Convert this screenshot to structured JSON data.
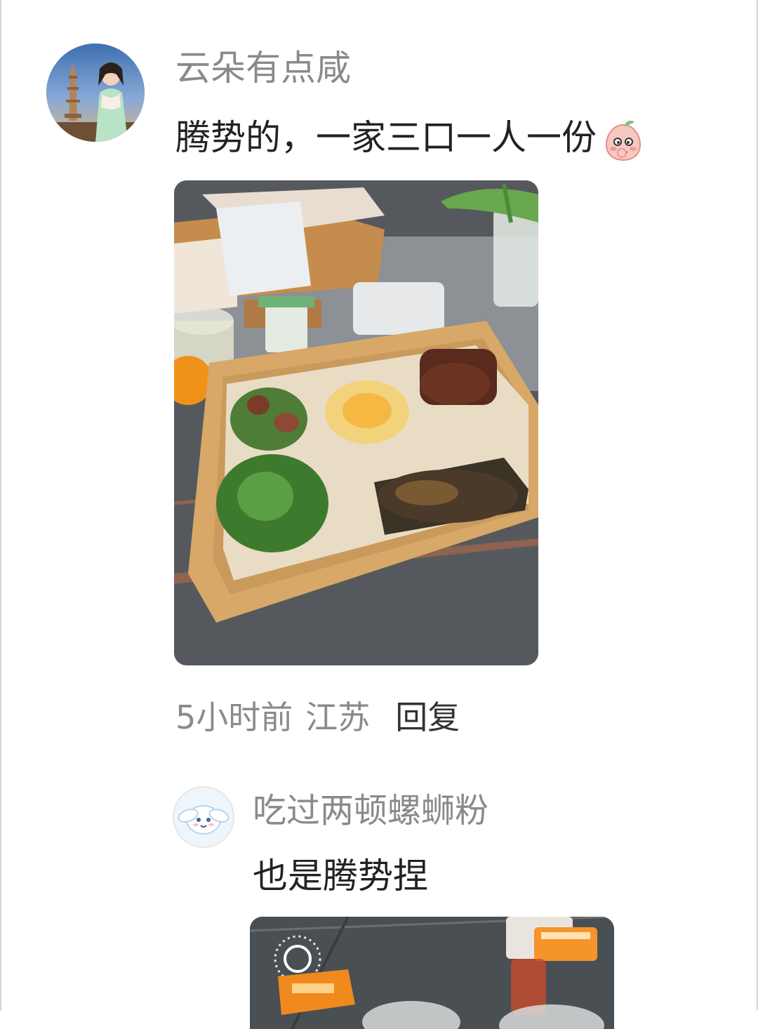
{
  "comment": {
    "username": "云朵有点咸",
    "text": "腾势的，一家三口一人一份",
    "emoji": "peach-blush-emoji",
    "time": "5小时前",
    "location": "江苏",
    "reply_label": "回复"
  },
  "reply": {
    "username": "吃过两顿螺蛳粉",
    "text": "也是腾势捏"
  }
}
